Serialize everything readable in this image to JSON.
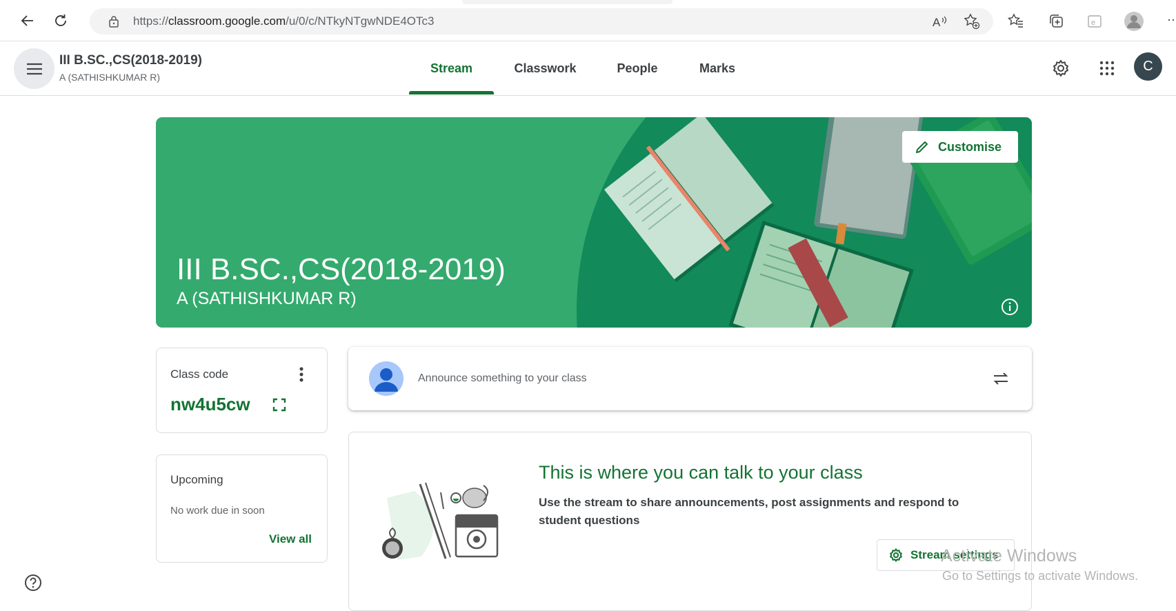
{
  "browser": {
    "url_prefix": "https://",
    "url_domain": "classroom.google.com",
    "url_path": "/u/0/c/NTkyNTgwNDE4OTc3",
    "more_label": "···"
  },
  "header": {
    "class_title": "III B.SC.,CS(2018-2019)",
    "class_section": "A (SATHISHKUMAR R)",
    "tabs": [
      {
        "label": "Stream",
        "active": true
      },
      {
        "label": "Classwork",
        "active": false
      },
      {
        "label": "People",
        "active": false
      },
      {
        "label": "Marks",
        "active": false
      }
    ],
    "account_initial": "C"
  },
  "banner": {
    "title": "III B.SC.,CS(2018-2019)",
    "subtitle": "A (SATHISHKUMAR R)",
    "customise_label": "Customise",
    "color": "#34aa6e"
  },
  "class_code": {
    "label": "Class code",
    "value": "nw4u5cw"
  },
  "upcoming": {
    "label": "Upcoming",
    "note": "No work due in soon",
    "view_all": "View all"
  },
  "announce": {
    "placeholder": "Announce something to your class"
  },
  "stream_intro": {
    "title": "This is where you can talk to your class",
    "description": "Use the stream to share announcements, post assignments and respond to student questions",
    "settings_label": "Stream settings"
  },
  "watermark": {
    "line1": "Activate Windows",
    "line2": "Go to Settings to activate Windows."
  },
  "colors": {
    "accent": "#137333",
    "banner": "#34aa6e"
  }
}
